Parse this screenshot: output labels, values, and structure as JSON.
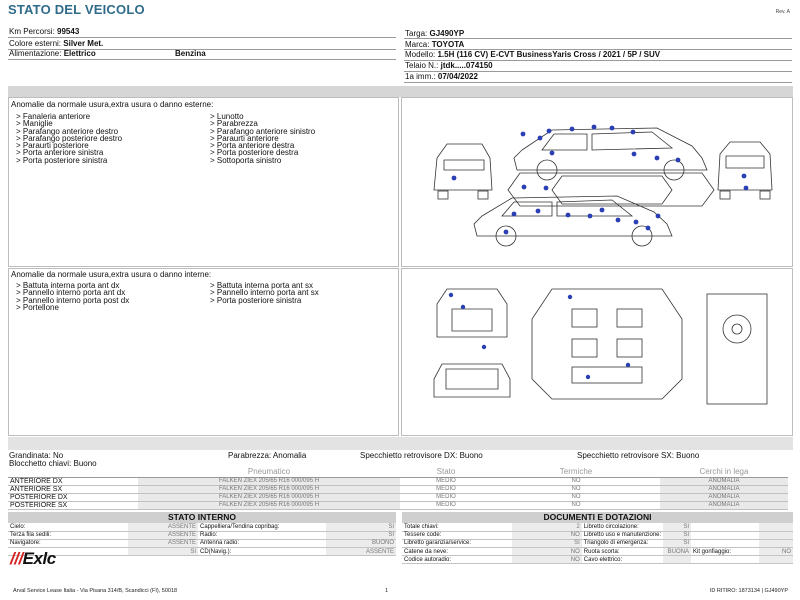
{
  "header": {
    "title": "STATO DEL VEICOLO",
    "revision": "Rev. A"
  },
  "vehicle": {
    "km_label": "Km Percorsi:",
    "km_value": "99543",
    "color_label": "Colore esterni:",
    "color_value": "Silver Met.",
    "fuel_label": "Alimentazione:",
    "fuel_value1": "Elettrico",
    "fuel_value2": "Benzina",
    "plate_label": "Targa:",
    "plate_value": "GJ490YP",
    "brand_label": "Marca:",
    "brand_value": "TOYOTA",
    "model_label": "Modello:",
    "model_value": "1.5H (116 CV) E-CVT BusinessYaris Cross / 2021 / 5P / SUV",
    "chassis_label": "Telaio N.:",
    "chassis_value": "jtdk.....074150",
    "reg_label": "1a imm.:",
    "reg_value": "07/04/2022"
  },
  "external": {
    "title": "Anomalie da normale usura,extra usura o danno esterne:",
    "col1": [
      "> Fanaleria anteriore",
      "> Maniglie",
      "> Parafango anteriore destro",
      "> Parafango posteriore destro",
      "> Paraurti posteriore",
      "> Porta anteriore sinistra",
      "> Porta posteriore sinistra"
    ],
    "col2": [
      "> Lunotto",
      "> Parabrezza",
      "> Parafango anteriore sinistro",
      "> Paraurti anteriore",
      "> Porta anteriore destra",
      "> Porta posteriore destra",
      "> Sottoporta sinistro"
    ]
  },
  "internal": {
    "title": "Anomalie da normale usura,extra usura o danno interne:",
    "col1": [
      "> Battuta interna porta ant dx",
      "> Pannello interno porta ant dx",
      "> Pannello interno porta post dx",
      "> Portellone"
    ],
    "col2": [
      "> Battuta interna porta ant sx",
      "> Pannello interno porta ant sx",
      "> Porta posteriore sinistra"
    ]
  },
  "checks": {
    "hail": "Grandinata: No",
    "windshield": "Parabrezza: Anomalia",
    "mirror_dx": "Specchietto retrovisore DX: Buono",
    "mirror_sx": "Specchietto retrovisore SX: Buono",
    "key_lock": "Blocchetto chiavi: Buono"
  },
  "tyres": {
    "headers": [
      "Pneumatico",
      "Stato",
      "Termiche",
      "Cerchi in lega"
    ],
    "rows": [
      {
        "pos": "ANTERIORE DX",
        "spec": "FALKEN ZIEX  205/65 R16 000/095 H",
        "state": "MEDIO",
        "thermal": "NO",
        "rims": "ANOMALIA"
      },
      {
        "pos": "ANTERIORE SX",
        "spec": "FALKEN ZIEX  205/65 R16 000/095 H",
        "state": "MEDIO",
        "thermal": "NO",
        "rims": "ANOMALIA"
      },
      {
        "pos": "POSTERIORE DX",
        "spec": "FALKEN ZIEX  205/65 R16 000/095 H",
        "state": "MEDIO",
        "thermal": "NO",
        "rims": "ANOMALIA"
      },
      {
        "pos": "POSTERIORE SX",
        "spec": "FALKEN ZIEX  205/65 R16 000/095 H",
        "state": "MEDIO",
        "thermal": "NO",
        "rims": "ANOMALIA"
      }
    ]
  },
  "internal_state": {
    "title": "STATO INTERNO",
    "rows": [
      {
        "l1": "Cielo:",
        "v1": "ASSENTE",
        "l2": "Cappelliera/Tendina copribag:",
        "v2": "SI"
      },
      {
        "l1": "Terza fila sedili:",
        "v1": "ASSENTE",
        "l2": "Radio:",
        "v2": "SI"
      },
      {
        "l1": "Navigatore:",
        "v1": "ASSENTE",
        "l2": "Antenna radio:",
        "v2": "BUONO"
      },
      {
        "l1": "",
        "v1": "SI",
        "l2": "CD(Navig.):",
        "v2": "ASSENTE"
      }
    ]
  },
  "documents": {
    "title": "DOCUMENTI E DOTAZIONI",
    "rows": [
      {
        "l1": "Totale chiavi:",
        "v1": "2",
        "l2": "Libretto circolazione:",
        "v2": "SI",
        "l3": "",
        "v3": ""
      },
      {
        "l1": "Tessere code:",
        "v1": "NO",
        "l2": "Libretto uso e manutenzione:",
        "v2": "SI",
        "l3": "",
        "v3": ""
      },
      {
        "l1": "Libretto garanzia/service:",
        "v1": "SI",
        "l2": "Triangolo di emergenza:",
        "v2": "SI",
        "l3": "",
        "v3": ""
      },
      {
        "l1": "Catene da neve:",
        "v1": "NO",
        "l2": "Ruota scorta:",
        "v2": "BUONA",
        "l3": "Kit gonfiaggio:",
        "v3": "NO"
      },
      {
        "l1": "Codice autoradio:",
        "v1": "NO",
        "l2": "Cavo elettrico:",
        "v2": "",
        "l3": "",
        "v3": ""
      }
    ]
  },
  "footer": {
    "address": "Arval Service Lease Italia - Via Pisana 314/B, Scandicci (FI), 50018",
    "page": "1",
    "ref": "ID RITIRO: 1873134 | GJ490YP"
  },
  "logo": {
    "bars": "///",
    "text": "Exlc"
  },
  "colors": {
    "title": "#2f6b8a",
    "damage_dot": "#2b3fb5",
    "logo_bars": "#d32222"
  }
}
